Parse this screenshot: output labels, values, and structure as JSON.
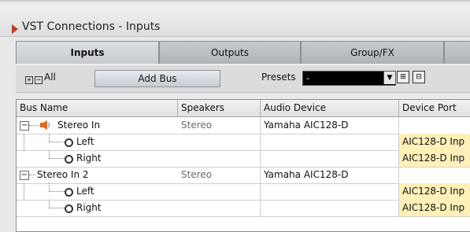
{
  "window": {
    "title": "VST Connections - Inputs"
  },
  "tabs": [
    {
      "label": "Inputs",
      "active": true
    },
    {
      "label": "Outputs",
      "active": false
    },
    {
      "label": "Group/FX",
      "active": false
    },
    {
      "label": "",
      "active": false
    }
  ],
  "toolbar": {
    "all_label": "All",
    "add_bus_label": "Add Bus",
    "presets_label": "Presets",
    "presets_value": "-"
  },
  "table": {
    "columns": [
      "Bus Name",
      "Speakers",
      "Audio Device",
      "Device Port"
    ],
    "rows": [
      {
        "name": "Stereo In",
        "speakers": "Stereo",
        "device": "Yamaha AIC128-D",
        "port": ""
      },
      {
        "name": "Left",
        "speakers": "",
        "device": "",
        "port": "AIC128-D Inp"
      },
      {
        "name": "Right",
        "speakers": "",
        "device": "",
        "port": "AIC128-D Inp"
      },
      {
        "name": "Stereo In 2",
        "speakers": "Stereo",
        "device": "Yamaha AIC128-D",
        "port": ""
      },
      {
        "name": "Left",
        "speakers": "",
        "device": "",
        "port": "AIC128-D Inp"
      },
      {
        "name": "Right",
        "speakers": "",
        "device": "",
        "port": "AIC128-D Inp"
      }
    ]
  },
  "icons": {
    "app": "cubase-logo-icon",
    "speaker": "speaker-icon",
    "expand_all": "expand-all-icon",
    "collapse_all": "collapse-all-icon",
    "channel": "channel-connector-icon"
  },
  "colors": {
    "port_highlight": "#fff0b8",
    "app_icon": "#c0392b"
  }
}
